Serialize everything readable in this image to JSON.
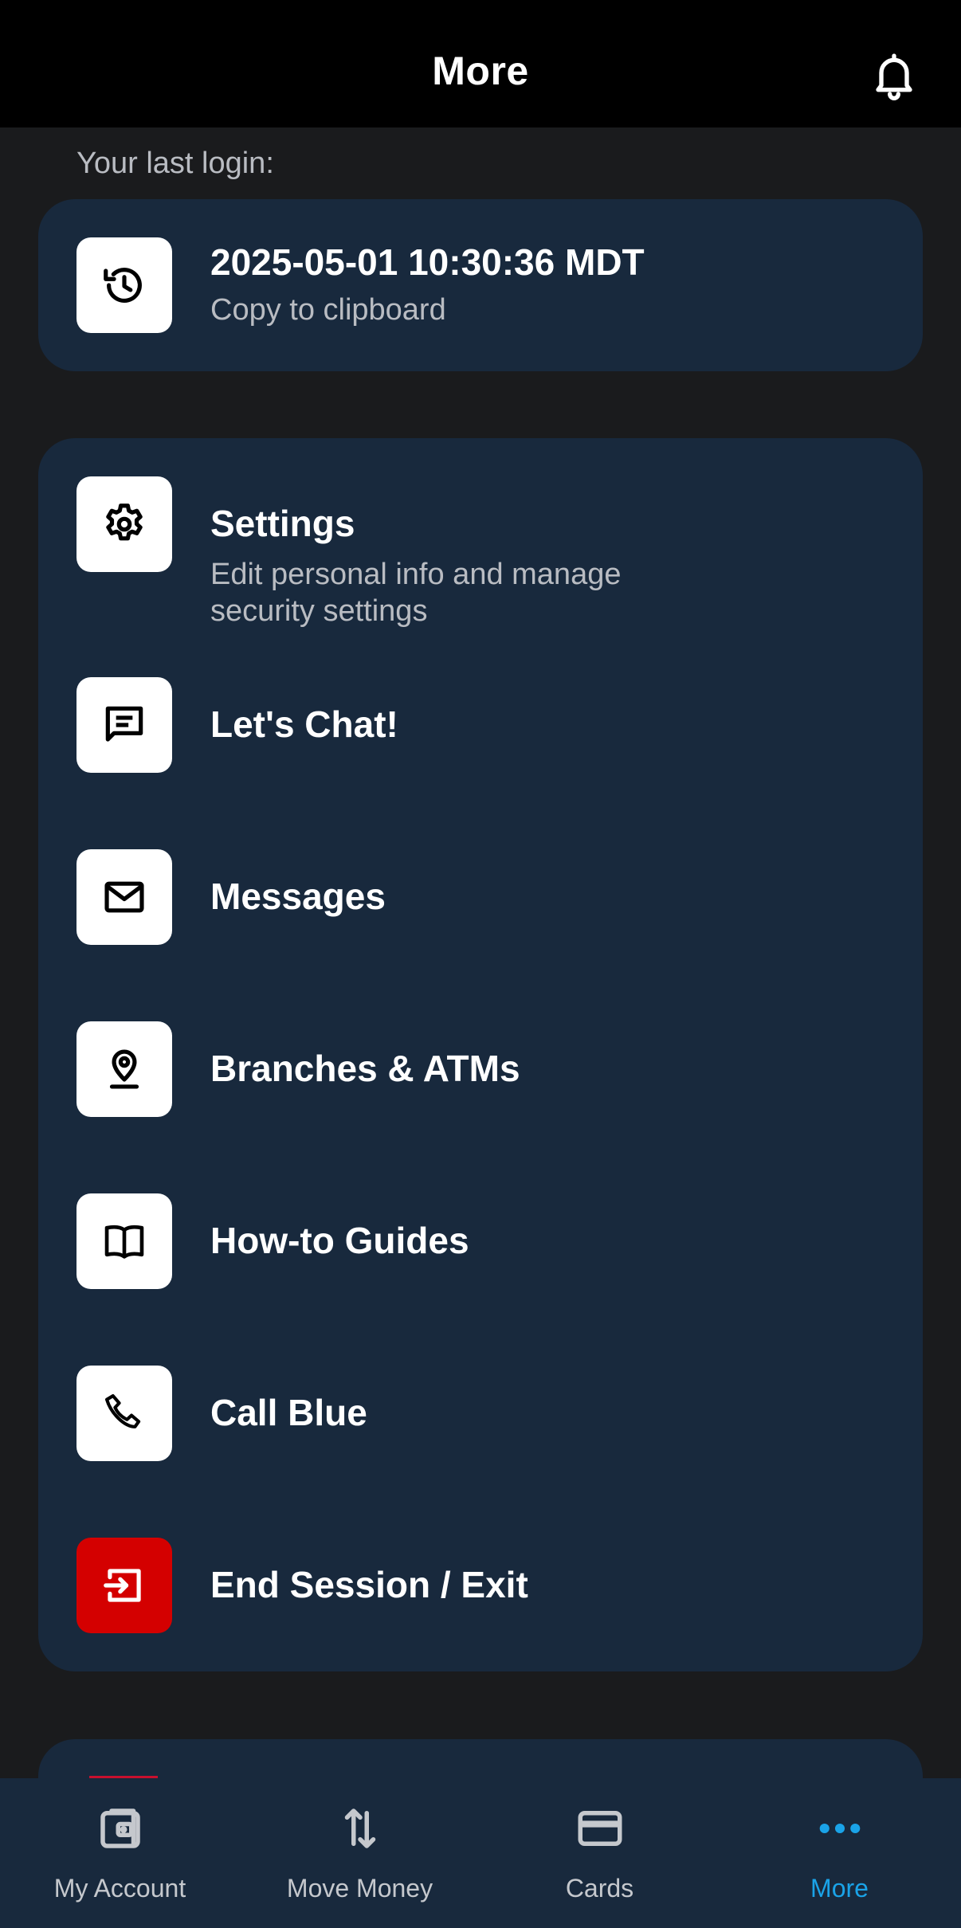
{
  "header": {
    "title": "More",
    "icon": "bell-icon"
  },
  "last_login": {
    "label": "Your last login:",
    "timestamp": "2025-05-01 10:30:36 MDT",
    "action": "Copy to clipboard",
    "icon": "history-icon"
  },
  "menu": {
    "items": [
      {
        "label": "Settings",
        "subtitle": "Edit personal info and manage security settings",
        "icon": "gear-icon"
      },
      {
        "label": "Let's Chat!",
        "icon": "chat-icon"
      },
      {
        "label": "Messages",
        "icon": "mail-icon"
      },
      {
        "label": "Branches & ATMs",
        "icon": "location-pin-icon"
      },
      {
        "label": "How-to Guides",
        "icon": "book-icon"
      },
      {
        "label": "Call Blue",
        "icon": "phone-icon"
      },
      {
        "label": "End Session / Exit",
        "icon": "exit-icon"
      }
    ]
  },
  "tabs": [
    {
      "label": "My Account",
      "icon": "wallet-icon"
    },
    {
      "label": "Move Money",
      "icon": "transfer-arrows-icon"
    },
    {
      "label": "Cards",
      "icon": "card-icon"
    },
    {
      "label": "More",
      "icon": "more-dots-icon",
      "active": true
    }
  ],
  "colors": {
    "background": "#1a1b1d",
    "card": "#18293d",
    "header": "#000000",
    "accent": "#1aa3e8",
    "danger": "#d40000"
  }
}
